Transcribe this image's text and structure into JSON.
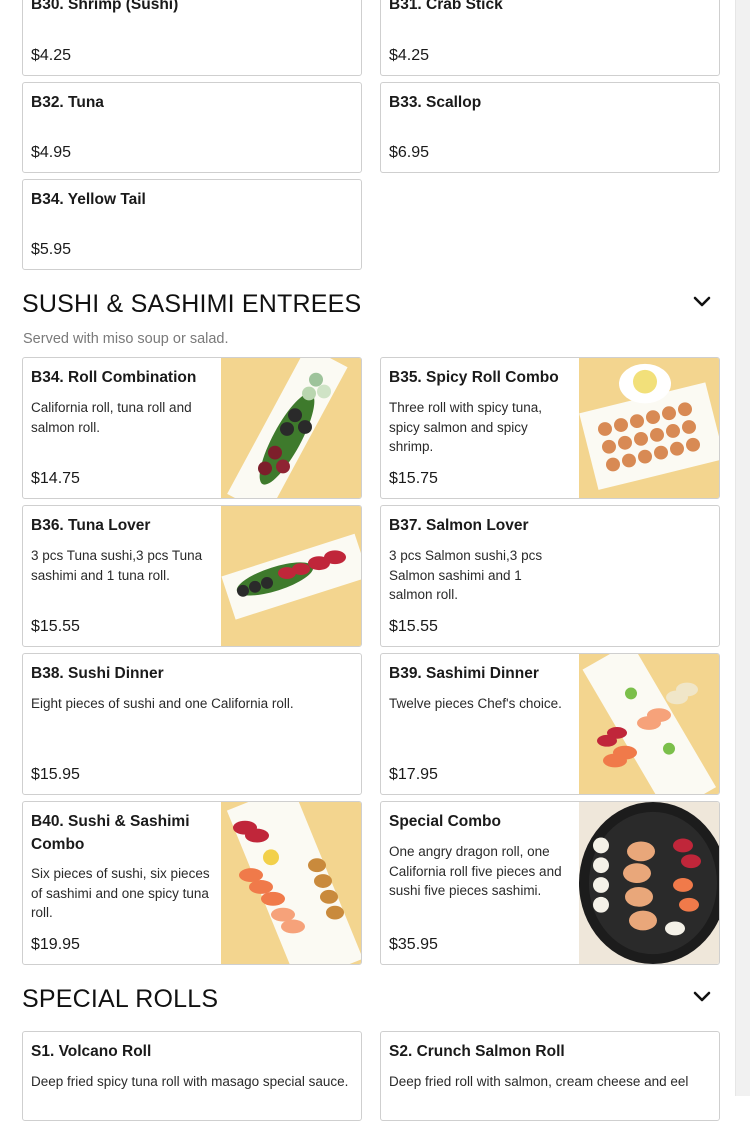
{
  "top_items": [
    {
      "name": "B30. Shrimp (Sushi)",
      "price": "$4.25"
    },
    {
      "name": "B31. Crab Stick",
      "price": "$4.25"
    },
    {
      "name": "B32. Tuna",
      "price": "$4.95"
    },
    {
      "name": "B33. Scallop",
      "price": "$6.95"
    },
    {
      "name": "B34. Yellow Tail",
      "price": "$5.95"
    }
  ],
  "entrees": {
    "title": "SUSHI & SASHIMI ENTREES",
    "subtitle": "Served with miso soup or salad.",
    "toggle_icon": "chevron-down-icon",
    "items": [
      {
        "name": "B34. Roll Combination",
        "desc": "California roll, tuna roll and salmon roll.",
        "price": "$14.75"
      },
      {
        "name": "B35. Spicy Roll Combo",
        "desc": "Three roll with spicy tuna, spicy salmon and spicy shrimp.",
        "price": "$15.75"
      },
      {
        "name": "B36. Tuna Lover",
        "desc": "3 pcs Tuna sushi,3 pcs Tuna sashimi and 1 tuna roll.",
        "price": "$15.55"
      },
      {
        "name": "B37. Salmon Lover",
        "desc": "3 pcs Salmon sushi,3 pcs Salmon sashimi and 1 salmon roll.",
        "price": "$15.55"
      },
      {
        "name": "B38. Sushi Dinner",
        "desc": "Eight pieces of sushi and one California roll.",
        "price": "$15.95"
      },
      {
        "name": "B39. Sashimi Dinner",
        "desc": "Twelve pieces Chef's choice.",
        "price": "$17.95"
      },
      {
        "name": "B40. Sushi & Sashimi Combo",
        "desc": "Six pieces of sushi, six pieces of sashimi and one spicy tuna roll.",
        "price": "$19.95"
      },
      {
        "name": "Special Combo",
        "desc": "One angry dragon roll, one California roll five pieces and sushi five pieces sashimi.",
        "price": "$35.95"
      }
    ]
  },
  "special_rolls": {
    "title": "SPECIAL ROLLS",
    "toggle_icon": "chevron-down-icon",
    "items": [
      {
        "name": "S1. Volcano Roll",
        "desc": "Deep fried spicy tuna roll with masago special sauce."
      },
      {
        "name": "S2. Crunch Salmon Roll",
        "desc": "Deep fried roll with salmon, cream cheese and eel"
      }
    ]
  },
  "colors": {
    "plate_bg": "#f3d58f",
    "border": "#cfcfcf",
    "subtitle": "#7a7a7a"
  }
}
